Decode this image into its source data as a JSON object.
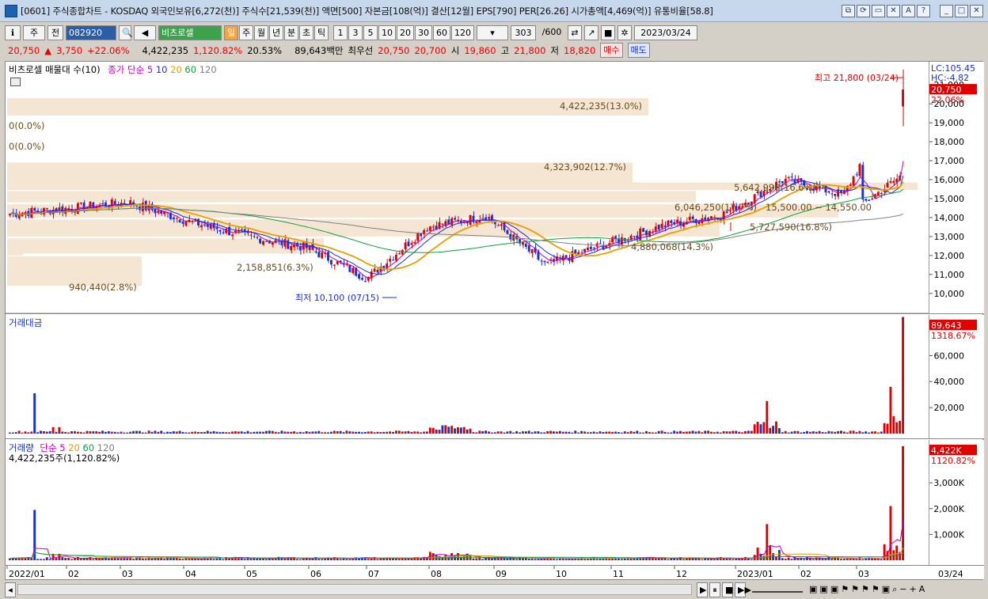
{
  "window": {
    "title": "[0601] 주식종합차트 - KOSDAQ 외국인보유[6,272(천)] 주식수[21,539(천)] 액면[500] 자본금[108(억)] 결산[12월] EPS[790] PER[26.26] 시가총액[4,469(억)] 유통비율[58.8]",
    "buttons": [
      "⧉",
      "⟳",
      "▭",
      "✕",
      "A",
      "?",
      "_",
      "□",
      "✕"
    ]
  },
  "toolbar": {
    "market": "주",
    "prev": "전",
    "code": "082920",
    "name": "비츠로셀",
    "periods": [
      "일",
      "주",
      "월",
      "년",
      "분",
      "초",
      "틱"
    ],
    "intervals": [
      "1",
      "3",
      "5",
      "10",
      "20",
      "30",
      "60",
      "120"
    ],
    "count": "303",
    "count_max": "/600",
    "date": "2023/03/24"
  },
  "quote": {
    "price": "20,750",
    "change_arrow": "▲",
    "change": "3,750",
    "change_pct": "+22.06%",
    "volume": "4,422,235",
    "volume_pct": "1,120.82%",
    "turnover": "20.53%",
    "amount": "89,643백만",
    "best_label": "최우선",
    "best_ask": "20,750",
    "best_bid": "20,700",
    "open_label": "시",
    "open": "19,860",
    "high_label": "고",
    "high": "21,800",
    "low_label": "저",
    "low": "18,820",
    "buy": "매수",
    "sell": "매도"
  },
  "price_panel": {
    "title": "비츠로셀 매물대 수(10)",
    "ma_label": "종가 단순",
    "ma_periods": [
      "5",
      "10",
      "20",
      "60",
      "120"
    ],
    "ma_colors": [
      "#c000c0",
      "#1a30d0",
      "#e8a000",
      "#10a040",
      "#808080"
    ],
    "high_note": "최고 21,800 (03/24)",
    "low_note": "최저 10,100 (07/15)",
    "profile_labels": [
      "4,422,235(13.0%)",
      "0(0.0%)",
      "0(0.0%)",
      "4,323,902(12.7%)",
      "5,642,998(16.6%)",
      "6,046,250(17.7%)",
      "15,500.00 ~ 14,550.00",
      "5,727,590(16.8%)",
      "4,880,068(14.3%)",
      "2,158,851(6.3%)",
      "940,440(2.8%)"
    ],
    "axis_ticks": [
      "21,000",
      "20,000",
      "19,000",
      "18,000",
      "17,000",
      "16,000",
      "15,000",
      "14,000",
      "13,000",
      "12,000",
      "11,000",
      "10,000"
    ],
    "lc": "LC:105.45",
    "hc": "HC:-4.82",
    "last_price": "20,750",
    "last_pct": "22.06%"
  },
  "amount_panel": {
    "title": "거래대금",
    "axis_ticks": [
      "60,000",
      "40,000",
      "20,000"
    ],
    "last_value": "89,643",
    "last_pct": "1318.67%"
  },
  "volume_panel": {
    "title": "거래량",
    "ma_label": "단순",
    "ma_periods": [
      "5",
      "20",
      "60",
      "120"
    ],
    "sub": "4,422,235주(1,120.82%)",
    "axis_ticks": [
      "3,000K",
      "2,000K",
      "1,000K"
    ],
    "last_value": "4,422K",
    "last_pct": "1120.82%"
  },
  "x_axis": {
    "labels": [
      "2022/01",
      "02",
      "03",
      "04",
      "05",
      "06",
      "07",
      "08",
      "09",
      "10",
      "11",
      "12",
      "2023/01",
      "02",
      "03"
    ],
    "last": "03/24"
  },
  "chart_data": {
    "type": "candlestick",
    "title": "비츠로셀",
    "ylim": [
      9700,
      21800
    ],
    "monthly_close": [
      14200,
      14500,
      14800,
      13800,
      13000,
      12400,
      10800,
      13500,
      14100,
      11500,
      12600,
      13600,
      14200,
      16000,
      15200,
      20750
    ],
    "high": 21800,
    "low": 10100
  }
}
